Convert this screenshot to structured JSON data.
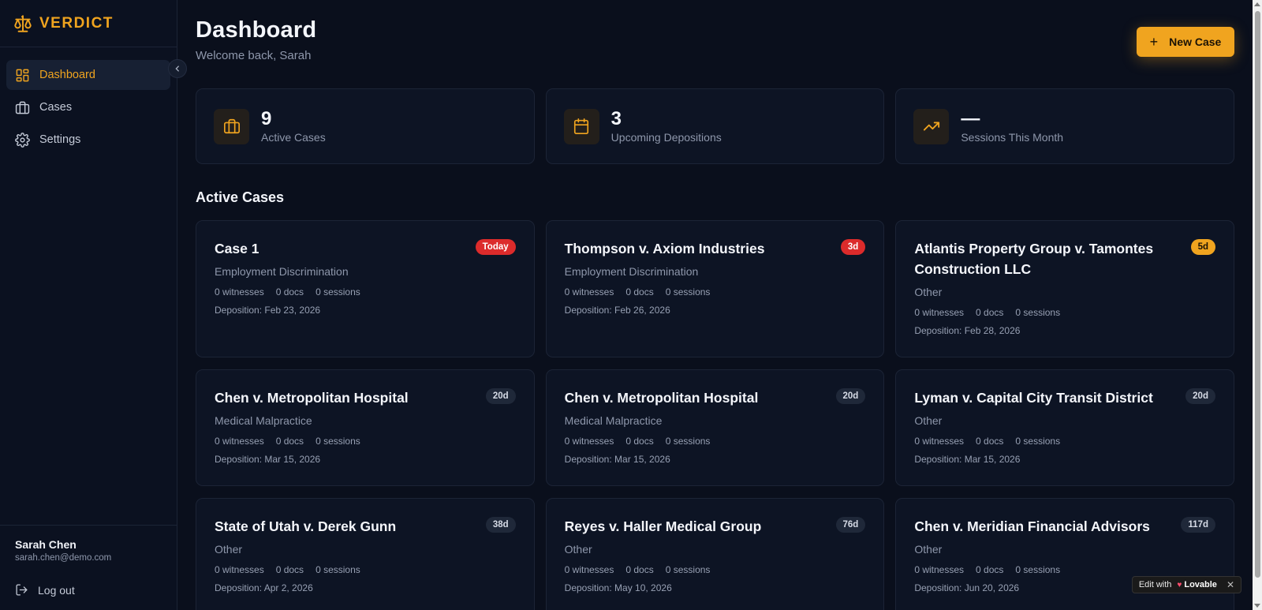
{
  "app": {
    "brand": "VERDICT",
    "accent": "#f0a41f"
  },
  "sidebar": {
    "items": [
      {
        "label": "Dashboard",
        "icon": "dashboard-icon",
        "active": true
      },
      {
        "label": "Cases",
        "icon": "briefcase-icon",
        "active": false
      },
      {
        "label": "Settings",
        "icon": "gear-icon",
        "active": false
      }
    ],
    "user": {
      "name": "Sarah Chen",
      "email": "sarah.chen@demo.com"
    },
    "logout_label": "Log out"
  },
  "header": {
    "title": "Dashboard",
    "subtitle": "Welcome back, Sarah",
    "new_case_label": "New Case"
  },
  "stats": [
    {
      "value": "9",
      "label": "Active Cases",
      "icon": "briefcase-icon"
    },
    {
      "value": "3",
      "label": "Upcoming Depositions",
      "icon": "calendar-icon"
    },
    {
      "value": "—",
      "label": "Sessions This Month",
      "icon": "trending-up-icon"
    }
  ],
  "section_title": "Active Cases",
  "cases": [
    {
      "title": "Case 1",
      "type": "Employment Discrimination",
      "witnesses": "0 witnesses",
      "docs": "0 docs",
      "sessions": "0 sessions",
      "deposition": "Deposition: Feb 23, 2026",
      "badge": "Today",
      "badge_style": "red"
    },
    {
      "title": "Thompson v. Axiom Industries",
      "type": "Employment Discrimination",
      "witnesses": "0 witnesses",
      "docs": "0 docs",
      "sessions": "0 sessions",
      "deposition": "Deposition: Feb 26, 2026",
      "badge": "3d",
      "badge_style": "red"
    },
    {
      "title": "Atlantis Property Group v. Tamontes Construction LLC",
      "type": "Other",
      "witnesses": "0 witnesses",
      "docs": "0 docs",
      "sessions": "0 sessions",
      "deposition": "Deposition: Feb 28, 2026",
      "badge": "5d",
      "badge_style": "amber"
    },
    {
      "title": "Chen v. Metropolitan Hospital",
      "type": "Medical Malpractice",
      "witnesses": "0 witnesses",
      "docs": "0 docs",
      "sessions": "0 sessions",
      "deposition": "Deposition: Mar 15, 2026",
      "badge": "20d",
      "badge_style": "gray"
    },
    {
      "title": "Chen v. Metropolitan Hospital",
      "type": "Medical Malpractice",
      "witnesses": "0 witnesses",
      "docs": "0 docs",
      "sessions": "0 sessions",
      "deposition": "Deposition: Mar 15, 2026",
      "badge": "20d",
      "badge_style": "gray"
    },
    {
      "title": "Lyman v. Capital City Transit District",
      "type": "Other",
      "witnesses": "0 witnesses",
      "docs": "0 docs",
      "sessions": "0 sessions",
      "deposition": "Deposition: Mar 15, 2026",
      "badge": "20d",
      "badge_style": "gray"
    },
    {
      "title": "State of Utah v. Derek Gunn",
      "type": "Other",
      "witnesses": "0 witnesses",
      "docs": "0 docs",
      "sessions": "0 sessions",
      "deposition": "Deposition: Apr 2, 2026",
      "badge": "38d",
      "badge_style": "gray"
    },
    {
      "title": "Reyes v. Haller Medical Group",
      "type": "Other",
      "witnesses": "0 witnesses",
      "docs": "0 docs",
      "sessions": "0 sessions",
      "deposition": "Deposition: May 10, 2026",
      "badge": "76d",
      "badge_style": "gray"
    },
    {
      "title": "Chen v. Meridian Financial Advisors",
      "type": "Other",
      "witnesses": "0 witnesses",
      "docs": "0 docs",
      "sessions": "0 sessions",
      "deposition": "Deposition: Jun 20, 2026",
      "badge": "117d",
      "badge_style": "gray"
    }
  ],
  "lovable_badge": {
    "prefix": "Edit with",
    "brand": "Lovable",
    "close": "✕"
  }
}
